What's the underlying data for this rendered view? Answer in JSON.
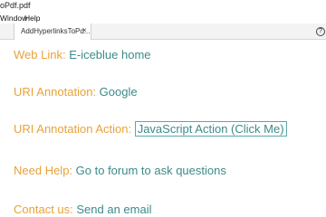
{
  "window": {
    "title": "oPdf.pdf"
  },
  "menubar": {
    "items": [
      "Window",
      "Help"
    ]
  },
  "tabs": [
    {
      "label": "AddHyperlinksToPd...",
      "close": "×"
    }
  ],
  "help_glyph": "?",
  "content": {
    "rows": [
      {
        "label": "Web Link: ",
        "link": "E-iceblue home"
      },
      {
        "label": "URI Annotation: ",
        "link": "Google"
      },
      {
        "label": "URI Annotation Action: ",
        "link": "JavaScript Action (Click Me)"
      },
      {
        "label": "Need Help: ",
        "link": "Go to forum to ask questions"
      },
      {
        "label": "Contact us: ",
        "link": "Send an email"
      }
    ]
  },
  "colors": {
    "label": "#e8a23a",
    "link": "#3d8a8a",
    "link_box": "#5aa8a8"
  }
}
